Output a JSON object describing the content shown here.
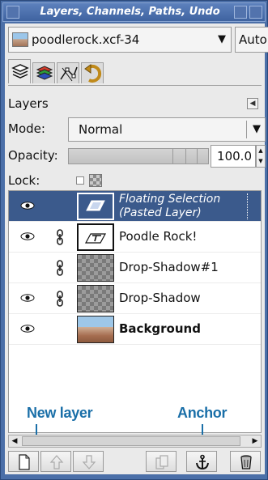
{
  "window": {
    "title": "Layers, Channels, Paths, Undo"
  },
  "image_selector": {
    "value": "poodlerock.xcf-34",
    "auto_label": "Auto"
  },
  "dock_tabs": [
    {
      "icon": "layers-tab-icon",
      "active": true
    },
    {
      "icon": "channels-tab-icon",
      "active": false
    },
    {
      "icon": "paths-tab-icon",
      "active": false
    },
    {
      "icon": "undo-tab-icon",
      "active": false
    }
  ],
  "dialog": {
    "title": "Layers",
    "mode_label": "Mode:",
    "mode_value": "Normal",
    "opacity_label": "Opacity:",
    "opacity_value": "100.0",
    "lock_label": "Lock:"
  },
  "layers": [
    {
      "name_line1": "Floating Selection",
      "name_line2": "(Pasted Layer)",
      "visible": true,
      "linked": false,
      "thumb": "floating",
      "selected": true
    },
    {
      "name": "Poodle Rock!",
      "visible": true,
      "linked": true,
      "thumb": "text",
      "selected": false
    },
    {
      "name": "Drop-Shadow#1",
      "visible": false,
      "linked": true,
      "thumb": "checker",
      "selected": false
    },
    {
      "name": "Drop-Shadow",
      "visible": true,
      "linked": true,
      "thumb": "checker",
      "selected": false
    },
    {
      "name": "Background",
      "visible": true,
      "linked": false,
      "thumb": "photo",
      "selected": false,
      "bold": true
    }
  ],
  "annotations": {
    "new_layer": "New layer",
    "anchor": "Anchor"
  },
  "buttons": [
    {
      "icon": "new-layer-icon",
      "enabled": true
    },
    {
      "icon": "raise-layer-icon",
      "enabled": false
    },
    {
      "icon": "lower-layer-icon",
      "enabled": false
    },
    {
      "icon": "duplicate-layer-icon",
      "enabled": false
    },
    {
      "icon": "anchor-icon",
      "enabled": true
    },
    {
      "icon": "delete-layer-icon",
      "enabled": true
    }
  ],
  "colors": {
    "title_bar": "#4b6fa8",
    "selected_row": "#3b5a8c",
    "annotation": "#1a6fa8"
  }
}
